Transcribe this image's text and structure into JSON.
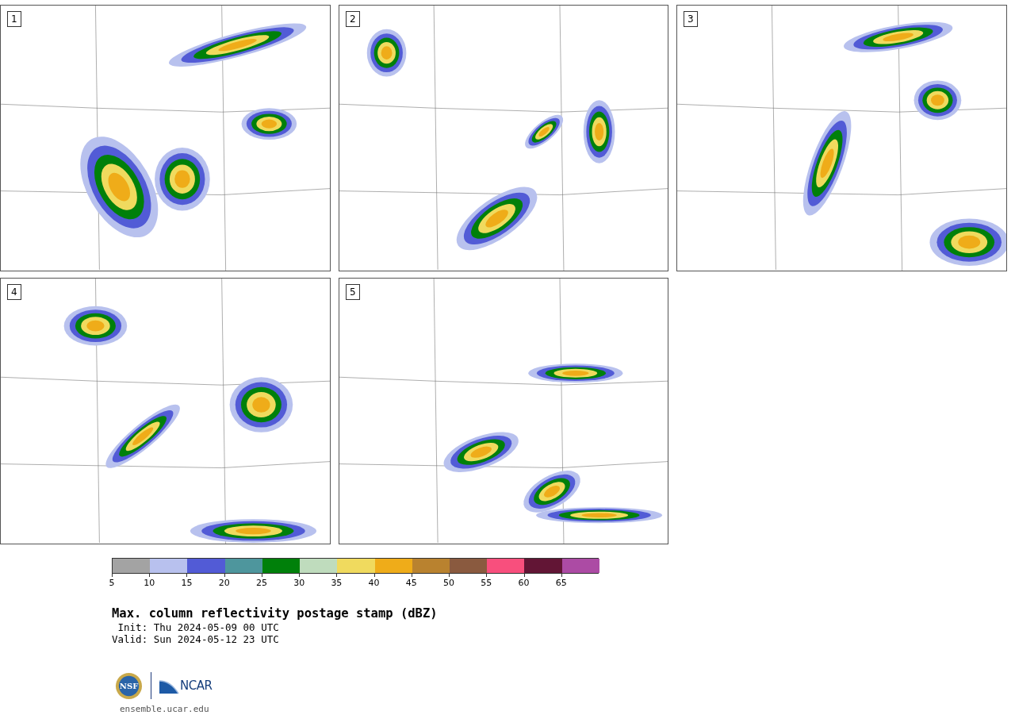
{
  "panels": [
    {
      "label": "1"
    },
    {
      "label": "2"
    },
    {
      "label": "3"
    },
    {
      "label": "4"
    },
    {
      "label": "5"
    }
  ],
  "colorbar": {
    "segments": [
      {
        "color": "#a3a3a3"
      },
      {
        "color": "#b8c1ee"
      },
      {
        "color": "#525bd6"
      },
      {
        "color": "#4e969d"
      },
      {
        "color": "#00800a"
      },
      {
        "color": "#bfdcbd"
      },
      {
        "color": "#f0da5e"
      },
      {
        "color": "#efac19"
      },
      {
        "color": "#b9822f"
      },
      {
        "color": "#8a5a3f"
      },
      {
        "color": "#f84f7d"
      },
      {
        "color": "#621535"
      },
      {
        "color": "#ac4ba4"
      }
    ],
    "ticks": [
      "5",
      "10",
      "15",
      "20",
      "25",
      "30",
      "35",
      "40",
      "45",
      "50",
      "55",
      "60",
      "65"
    ]
  },
  "title": "Max. column reflectivity postage stamp (dBZ)",
  "init": " Init: Thu 2024-05-09 00 UTC",
  "valid": "Valid: Sun 2024-05-12 23 UTC",
  "logos": {
    "nsf": "NSF",
    "ncar": "NCAR"
  },
  "url": "ensemble.ucar.edu"
}
